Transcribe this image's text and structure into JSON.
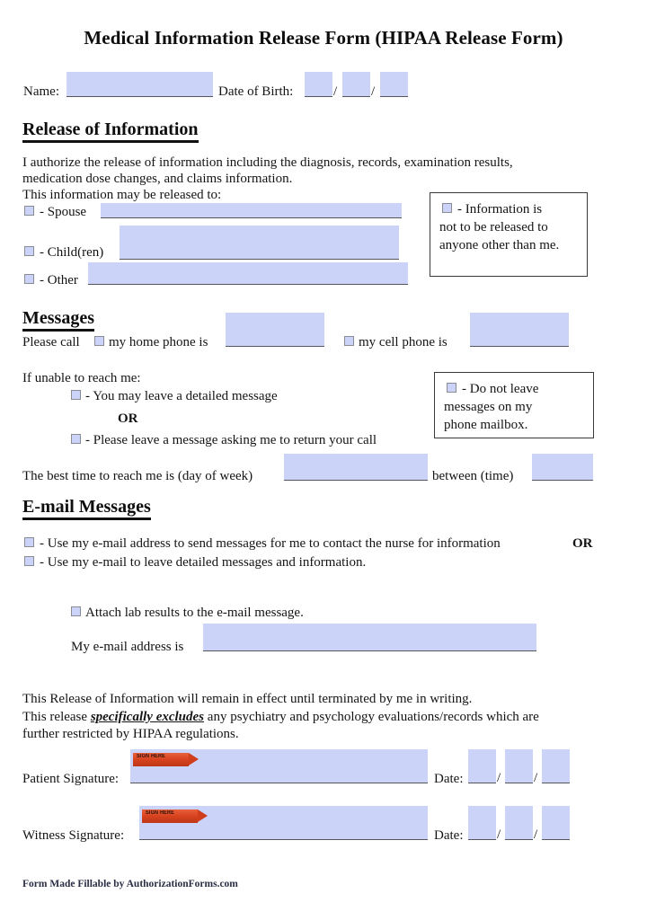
{
  "document": {
    "title": "Medical Information Release Form (HIPAA Release Form)",
    "footer": "Form Made Fillable by AuthorizationForms.com"
  },
  "identity": {
    "name_label": "Name:",
    "name_value": "",
    "dob_label": "Date of Birth:",
    "dob_month": "",
    "dob_day": "",
    "dob_year": "",
    "slash1": "/",
    "slash2": "/"
  },
  "release_of_information": {
    "heading": "Release of Information",
    "paragraph_line1": "I authorize the release of information including the diagnosis, records, examination results,",
    "paragraph_line2": "medication dose changes, and claims information.",
    "paragraph_line3": "This information may be released to:",
    "options": [
      {
        "label": "- Spouse",
        "value": ""
      },
      {
        "label": "- Child(ren)",
        "value": ""
      },
      {
        "label": "- Other",
        "value": ""
      }
    ],
    "note": {
      "line1": "- Information is",
      "line2": "not to be released to",
      "line3": "anyone other than me."
    }
  },
  "messages": {
    "heading": "Messages",
    "please_call_label": "Please call",
    "home_phone_label": "my home phone is",
    "home_phone_value": "",
    "cell_phone_label": "my cell phone is",
    "cell_phone_value": "",
    "if_unable_label": "If unable to reach me:",
    "option_detailed": "- You may leave a detailed message",
    "or_label": "OR",
    "option_return_call": "- Please leave a message asking me to return your call",
    "best_time_label": "The best time to reach me is (day of week)",
    "best_time_day_value": "",
    "between_label": "between (time)",
    "between_time_value": "",
    "note": {
      "line1": "- Do not leave",
      "line2": "messages on my",
      "line3": "phone mailbox."
    }
  },
  "email_messages": {
    "heading": "E-mail Messages",
    "option_nurse": "- Use my e-mail address to send messages for me to contact the nurse for information",
    "or_label": "OR",
    "option_detailed": "-  Use my e-mail to leave detailed messages and information.",
    "attach_lab_label": "Attach lab results to the e-mail message.",
    "email_address_label": "My e-mail address is",
    "email_address_value": ""
  },
  "terms": {
    "line1": "This Release of Information will remain in effect until terminated by me in writing.",
    "line2_part1": "This release ",
    "line2_emphasis": "specifically excludes",
    "line2_part2": " any psychiatry and psychology evaluations/records which are",
    "line3": "further restricted by HIPAA regulations."
  },
  "signatures": {
    "patient": {
      "label": "Patient Signature:",
      "value": "",
      "tag_label": "SIGN HERE",
      "date_label": "Date:",
      "date_month": "",
      "date_day": "",
      "date_year": "",
      "slash1": "/",
      "slash2": "/"
    },
    "witness": {
      "label": "Witness Signature:",
      "value": "",
      "tag_label": "SIGN HERE",
      "date_label": "Date:",
      "date_month": "",
      "date_day": "",
      "date_year": "",
      "slash1": "/",
      "slash2": "/"
    }
  },
  "colors": {
    "field_fill": "#ccd3f8",
    "field_underline": "#55565a",
    "checkbox_border": "#8a8c94",
    "sign_tag": "#d8431f",
    "text": "#141414"
  }
}
